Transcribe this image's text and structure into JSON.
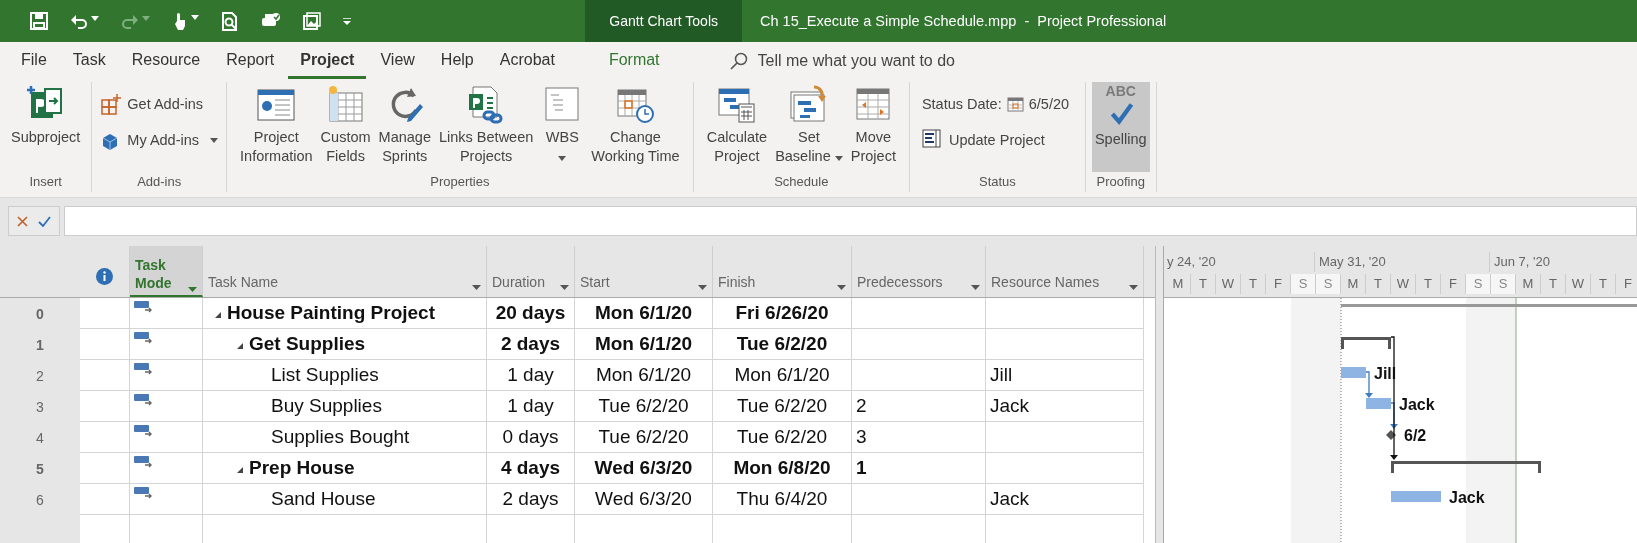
{
  "title_bar": {
    "quick_access": [
      {
        "kind": "save",
        "disabled": false,
        "dropdown": false
      },
      {
        "kind": "undo",
        "disabled": false,
        "dropdown": true
      },
      {
        "kind": "redo",
        "disabled": true,
        "dropdown": true
      },
      {
        "kind": "touch",
        "disabled": false,
        "dropdown": true
      },
      {
        "kind": "print-preview",
        "disabled": false,
        "dropdown": false
      },
      {
        "kind": "spell-print",
        "disabled": false,
        "dropdown": false
      },
      {
        "kind": "picture",
        "disabled": false,
        "dropdown": false
      },
      {
        "kind": "customize",
        "disabled": false,
        "dropdown": false
      }
    ],
    "contextual": "Gantt Chart Tools",
    "title": "Ch 15_Execute a Simple Schedule.mpp  -  Project Professional"
  },
  "menu_tabs": [
    {
      "label": "File",
      "selected": false,
      "kind": "normal"
    },
    {
      "label": "Task",
      "selected": false,
      "kind": "normal"
    },
    {
      "label": "Resource",
      "selected": false,
      "kind": "normal"
    },
    {
      "label": "Report",
      "selected": false,
      "kind": "normal"
    },
    {
      "label": "Project",
      "selected": true,
      "kind": "normal"
    },
    {
      "label": "View",
      "selected": false,
      "kind": "normal"
    },
    {
      "label": "Help",
      "selected": false,
      "kind": "normal"
    },
    {
      "label": "Acrobat",
      "selected": false,
      "kind": "normal"
    },
    {
      "label": "Format",
      "selected": false,
      "kind": "contextual"
    }
  ],
  "tell_me": {
    "placeholder": "Tell me what you want to do"
  },
  "ribbon": [
    {
      "label": "Insert",
      "items": [
        {
          "kind": "large",
          "label": "Subproject",
          "dropdown": false,
          "selected": false
        }
      ]
    },
    {
      "label": "Add-ins",
      "items": [
        {
          "kind": "small",
          "label": "Get Add-ins",
          "dropdown": false,
          "selected": false
        },
        {
          "kind": "small",
          "label": "My Add-ins",
          "dropdown": true,
          "selected": false
        }
      ]
    },
    {
      "label": "Properties",
      "items": [
        {
          "kind": "large",
          "label": "Project\nInformation",
          "dropdown": false,
          "selected": false
        },
        {
          "kind": "large",
          "label": "Custom\nFields",
          "dropdown": false,
          "selected": false
        },
        {
          "kind": "large",
          "label": "Manage\nSprints",
          "dropdown": false,
          "selected": false
        },
        {
          "kind": "large",
          "label": "Links Between\nProjects",
          "dropdown": false,
          "selected": false
        },
        {
          "kind": "large",
          "label": "WBS",
          "dropdown": true,
          "selected": false
        },
        {
          "kind": "large",
          "label": "Change\nWorking Time",
          "dropdown": false,
          "selected": false
        }
      ]
    },
    {
      "label": "Schedule",
      "items": [
        {
          "kind": "large",
          "label": "Calculate\nProject",
          "dropdown": false,
          "selected": false
        },
        {
          "kind": "large",
          "label": "Set\nBaseline",
          "dropdown": true,
          "selected": false
        },
        {
          "kind": "large",
          "label": "Move\nProject",
          "dropdown": false,
          "selected": false
        }
      ]
    },
    {
      "label": "Status",
      "items": [
        {
          "kind": "status-date",
          "label": "Status Date:",
          "value": "6/5/20",
          "dropdown": false,
          "selected": false
        },
        {
          "kind": "small",
          "label": "Update Project",
          "dropdown": false,
          "selected": false
        }
      ]
    },
    {
      "label": "Proofing",
      "items": [
        {
          "kind": "large",
          "caption": "ABC",
          "label": "Spelling",
          "dropdown": false,
          "selected": true
        }
      ]
    }
  ],
  "table": {
    "columns": [
      {
        "kind": "indicators",
        "filter": false,
        "selected": false
      },
      {
        "kind": "mode",
        "label": "Task\nMode",
        "filter": true,
        "selected": true
      },
      {
        "kind": "name",
        "label": "Task Name",
        "filter": true,
        "selected": false
      },
      {
        "kind": "duration",
        "label": "Duration",
        "filter": true,
        "selected": false
      },
      {
        "kind": "start",
        "label": "Start",
        "filter": true,
        "selected": false
      },
      {
        "kind": "finish",
        "label": "Finish",
        "filter": true,
        "selected": false
      },
      {
        "kind": "predecessors",
        "label": "Predecessors",
        "filter": true,
        "selected": false
      },
      {
        "kind": "resources",
        "label": "Resource Names",
        "filter": true,
        "selected": false
      }
    ],
    "tasks": [
      {
        "id": "0",
        "name": "House Painting Project",
        "duration": "20 days",
        "start": "Mon 6/1/20",
        "finish": "Fri 6/26/20",
        "summary": true,
        "expanded": true,
        "children": [
          {
            "id": "1",
            "name": "Get Supplies",
            "duration": "2 days",
            "start": "Mon 6/1/20",
            "finish": "Tue 6/2/20",
            "summary": true,
            "expanded": true,
            "children": [
              {
                "id": "2",
                "name": "List Supplies",
                "duration": "1 day",
                "start": "Mon 6/1/20",
                "finish": "Mon 6/1/20",
                "resources": "Jill",
                "summary": false
              },
              {
                "id": "3",
                "name": "Buy Supplies",
                "duration": "1 day",
                "start": "Tue 6/2/20",
                "finish": "Tue 6/2/20",
                "predecessors": "2",
                "resources": "Jack",
                "summary": false
              },
              {
                "id": "4",
                "name": "Supplies Bought",
                "duration": "0 days",
                "start": "Tue 6/2/20",
                "finish": "Tue 6/2/20",
                "predecessors": "3",
                "summary": false
              }
            ]
          },
          {
            "id": "5",
            "name": "Prep House",
            "duration": "4 days",
            "start": "Wed 6/3/20",
            "finish": "Mon 6/8/20",
            "predecessors": "1",
            "summary": true,
            "expanded": true,
            "children": [
              {
                "id": "6",
                "name": "Sand House",
                "duration": "2 days",
                "start": "Wed 6/3/20",
                "finish": "Thu 6/4/20",
                "resources": "Jack",
                "summary": false
              }
            ]
          }
        ]
      }
    ]
  },
  "gantt": {
    "weeks": [
      {
        "label": "y 24, '20",
        "days": [
          {
            "label": "M",
            "nonworking": false
          },
          {
            "label": "T",
            "nonworking": false
          },
          {
            "label": "W",
            "nonworking": false
          },
          {
            "label": "T",
            "nonworking": false
          },
          {
            "label": "F",
            "nonworking": false
          },
          {
            "label": "S",
            "nonworking": true
          }
        ]
      },
      {
        "label": "May 31, '20",
        "days": [
          {
            "label": "S",
            "nonworking": true
          },
          {
            "label": "M",
            "nonworking": false
          },
          {
            "label": "T",
            "nonworking": false
          },
          {
            "label": "W",
            "nonworking": false
          },
          {
            "label": "T",
            "nonworking": false
          },
          {
            "label": "F",
            "nonworking": false
          },
          {
            "label": "S",
            "nonworking": true
          }
        ]
      },
      {
        "label": "Jun 7, '20",
        "days": [
          {
            "label": "S",
            "nonworking": true
          },
          {
            "label": "M",
            "nonworking": false
          },
          {
            "label": "T",
            "nonworking": false
          },
          {
            "label": "W",
            "nonworking": false
          },
          {
            "label": "T",
            "nonworking": false
          },
          {
            "label": "F",
            "nonworking": false
          }
        ]
      }
    ],
    "bars": [
      {
        "kind": "project"
      },
      {
        "kind": "summary"
      },
      {
        "kind": "task",
        "label": "Jill"
      },
      {
        "kind": "task",
        "label": "Jack"
      },
      {
        "kind": "milestone",
        "label": "6/2"
      },
      {
        "kind": "summary"
      },
      {
        "kind": "task",
        "label": "Jack"
      }
    ]
  }
}
